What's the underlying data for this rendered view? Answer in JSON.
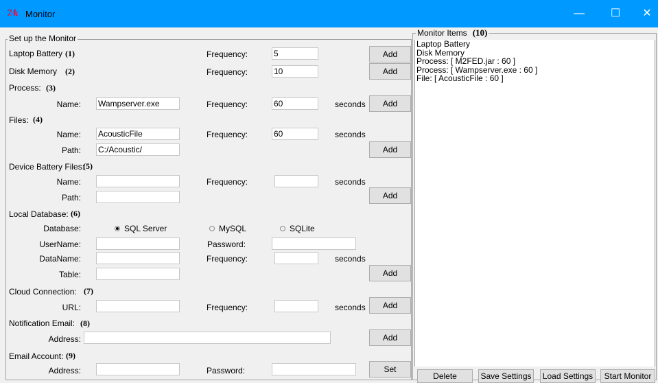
{
  "window": {
    "title": "Monitor",
    "app_icon": "tk-feather-icon",
    "minimize_glyph": "—",
    "maximize_glyph": "☐",
    "close_glyph": "✕"
  },
  "setup": {
    "legend": "Set up the Monitor",
    "laptop": {
      "label": "Laptop Battery",
      "num": "(1)",
      "freq_label": "Frequency:",
      "freq": "5",
      "add": "Add"
    },
    "disk": {
      "label": "Disk Memory",
      "num": "(2)",
      "freq_label": "Frequency:",
      "freq": "10",
      "add": "Add"
    },
    "process": {
      "label": "Process:",
      "num": "(3)",
      "name_label": "Name:",
      "name": "Wampserver.exe",
      "freq_label": "Frequency:",
      "freq": "60",
      "seconds": "seconds",
      "add": "Add"
    },
    "files": {
      "label": "Files:",
      "num": "(4)",
      "name_label": "Name:",
      "name": "AcousticFile",
      "freq_label": "Frequency:",
      "freq": "60",
      "seconds": "seconds",
      "path_label": "Path:",
      "path": "C:/Acoustic/",
      "add": "Add"
    },
    "device": {
      "label": "Device Battery Files:",
      "num": "(5)",
      "name_label": "Name:",
      "name": "",
      "freq_label": "Frequency:",
      "freq": "",
      "seconds": "seconds",
      "path_label": "Path:",
      "path": "",
      "add": "Add"
    },
    "localdb": {
      "label": "Local Database:",
      "num": "(6)",
      "db_label": "Database:",
      "options": [
        "SQL Server",
        "MySQL",
        "SQLite"
      ],
      "selected": "SQL Server",
      "user_label": "UserName:",
      "user": "",
      "pass_label": "Password:",
      "pass": "",
      "dataname_label": "DataName:",
      "dataname": "",
      "freq_label": "Frequency:",
      "freq": "",
      "seconds": "seconds",
      "table_label": "Table:",
      "table": "",
      "add": "Add"
    },
    "cloud": {
      "label": "Cloud Connection:",
      "num": "(7)",
      "url_label": "URL:",
      "url": "",
      "freq_label": "Frequency:",
      "freq": "",
      "seconds": "seconds",
      "add": "Add"
    },
    "notify": {
      "label": "Notification Email:",
      "num": "(8)",
      "addr_label": "Address:",
      "addr": "",
      "add": "Add"
    },
    "email": {
      "label": "Email Account:",
      "num": "(9)",
      "addr_label": "Address:",
      "addr": "",
      "pass_label": "Password:",
      "pass": "",
      "set": "Set"
    }
  },
  "monitor": {
    "legend": "Monitor Items",
    "num": "(10)",
    "items": [
      "Laptop Battery",
      "Disk Memory",
      "Process:  [ M2FED.jar : 60 ]",
      "Process:  [ Wampserver.exe : 60 ]",
      "File:  [ AcousticFile : 60 ]"
    ],
    "buttons": {
      "delete": "Delete",
      "save": "Save Settings",
      "load": "Load Settings",
      "start": "Start Monitor"
    }
  }
}
